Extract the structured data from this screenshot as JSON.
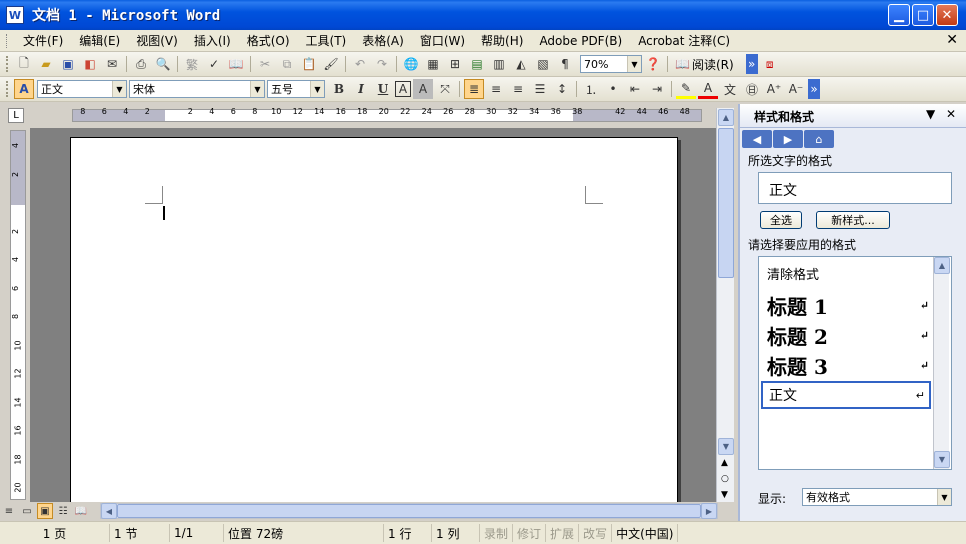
{
  "window": {
    "title": "文档 1 - Microsoft Word",
    "app_icon": "W"
  },
  "menu": [
    "文件(F)",
    "编辑(E)",
    "视图(V)",
    "插入(I)",
    "格式(O)",
    "工具(T)",
    "表格(A)",
    "窗口(W)",
    "帮助(H)",
    "Adobe PDF(B)",
    "Acrobat 注释(C)"
  ],
  "toolbar": {
    "zoom": "70%",
    "read_label": "阅读(R)",
    "traditional": "繁"
  },
  "format_bar": {
    "style": "正文",
    "font": "宋体",
    "size": "五号",
    "bold": "B",
    "italic": "I",
    "underline": "U"
  },
  "ruler": {
    "numbers": [
      "8",
      "6",
      "4",
      "2",
      "",
      "2",
      "4",
      "6",
      "8",
      "10",
      "12",
      "14",
      "16",
      "18",
      "20",
      "22",
      "24",
      "26",
      "28",
      "30",
      "32",
      "34",
      "36",
      "38",
      "",
      "42",
      "44",
      "46",
      "48"
    ],
    "vnumbers": [
      "4",
      "2",
      "",
      "2",
      "4",
      "6",
      "8",
      "10",
      "12",
      "14",
      "16",
      "18",
      "20"
    ]
  },
  "taskpane": {
    "title": "样式和格式",
    "current_label": "所选文字的格式",
    "current_style": "正文",
    "select_all": "全选",
    "new_style": "新样式...",
    "apply_label": "请选择要应用的格式",
    "styles": [
      "清除格式",
      "标题 1",
      "标题 2",
      "标题 3",
      "正文"
    ],
    "show_label": "显示:",
    "show_value": "有效格式"
  },
  "status": {
    "page": "1 页",
    "section": "1 节",
    "pages": "1/1",
    "position": "位置 72磅",
    "line": "1 行",
    "col": "1 列",
    "rec": "录制",
    "trk": "修订",
    "ext": "扩展",
    "ovr": "改写",
    "lang": "中文(中国)"
  }
}
